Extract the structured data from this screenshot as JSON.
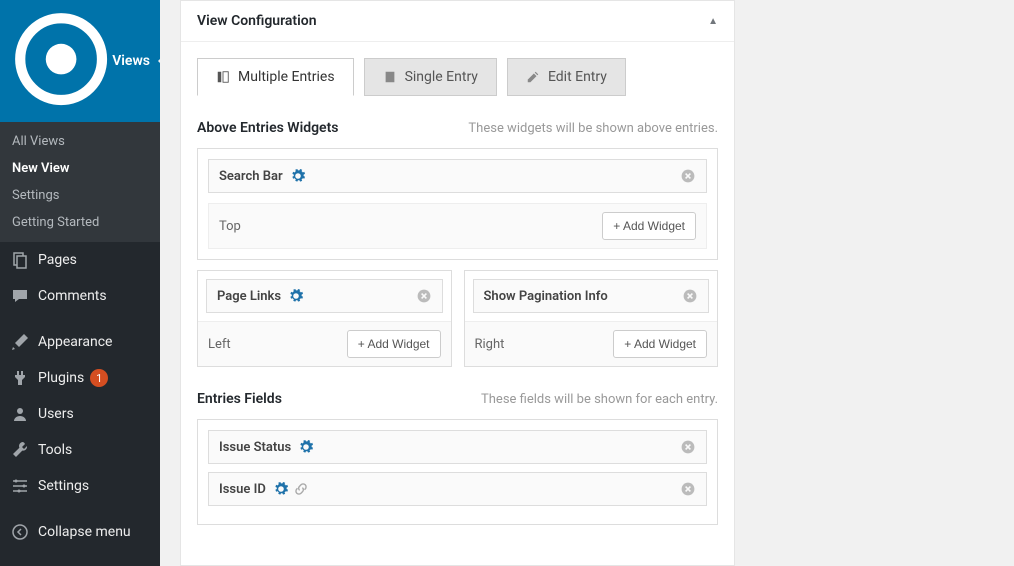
{
  "sidebar": {
    "current": {
      "label": "Views"
    },
    "submenu": [
      {
        "label": "All Views",
        "active": false
      },
      {
        "label": "New View",
        "active": true
      },
      {
        "label": "Settings",
        "active": false
      },
      {
        "label": "Getting Started",
        "active": false
      }
    ],
    "items": [
      {
        "label": "Pages",
        "icon": "pages"
      },
      {
        "label": "Comments",
        "icon": "comment"
      },
      {
        "label": "Appearance",
        "icon": "brush"
      },
      {
        "label": "Plugins",
        "icon": "plug",
        "badge": "1"
      },
      {
        "label": "Users",
        "icon": "user"
      },
      {
        "label": "Tools",
        "icon": "wrench"
      },
      {
        "label": "Settings",
        "icon": "sliders"
      }
    ],
    "collapse": "Collapse menu"
  },
  "panel": {
    "title": "View Configuration"
  },
  "tabs": [
    {
      "label": "Multiple Entries",
      "active": true
    },
    {
      "label": "Single Entry",
      "active": false
    },
    {
      "label": "Edit Entry",
      "active": false
    }
  ],
  "sections": {
    "above": {
      "title": "Above Entries Widgets",
      "hint": "These widgets will be shown above entries.",
      "zones": {
        "top": {
          "label": "Top",
          "add": "+ Add Widget",
          "widgets": [
            {
              "label": "Search Bar",
              "gear": true
            }
          ]
        },
        "left": {
          "label": "Left",
          "add": "+ Add Widget",
          "widgets": [
            {
              "label": "Page Links",
              "gear": true
            }
          ]
        },
        "right": {
          "label": "Right",
          "add": "+ Add Widget",
          "widgets": [
            {
              "label": "Show Pagination Info",
              "gear": false
            }
          ]
        }
      }
    },
    "entries": {
      "title": "Entries Fields",
      "hint": "These fields will be shown for each entry.",
      "widgets": [
        {
          "label": "Issue Status",
          "gear": true,
          "link": false
        },
        {
          "label": "Issue ID",
          "gear": true,
          "link": true
        }
      ]
    }
  }
}
